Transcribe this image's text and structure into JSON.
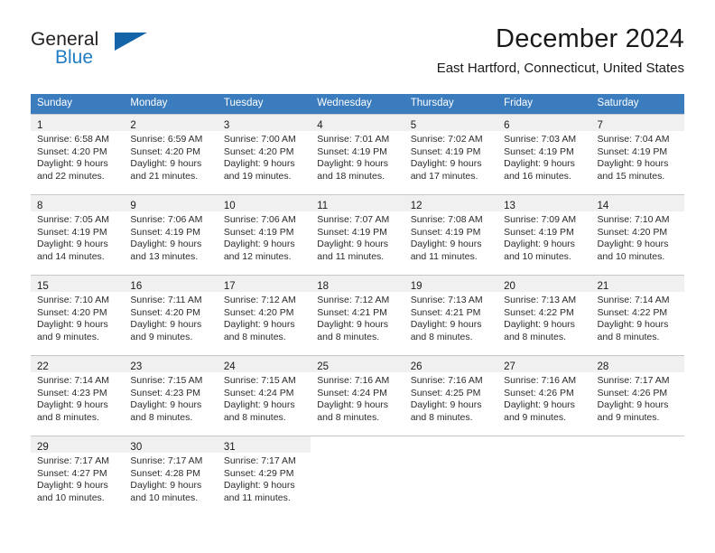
{
  "brand": {
    "name_top": "General",
    "name_bottom": "Blue",
    "triangle_icon": "triangle-logo-icon",
    "colors": {
      "blue": "#1f7dc4",
      "triangle": "#1464aa",
      "dark": "#231f20"
    }
  },
  "header": {
    "title": "December 2024",
    "subtitle": "East Hartford, Connecticut, United States"
  },
  "calendar": {
    "header_color": "#3a7cbe",
    "daynum_band_color": "#f0f0f0",
    "weekdays": [
      "Sunday",
      "Monday",
      "Tuesday",
      "Wednesday",
      "Thursday",
      "Friday",
      "Saturday"
    ],
    "weeks": [
      [
        {
          "day": "1",
          "sunrise": "Sunrise: 6:58 AM",
          "sunset": "Sunset: 4:20 PM",
          "daylight_line1": "Daylight: 9 hours",
          "daylight_line2": "and 22 minutes."
        },
        {
          "day": "2",
          "sunrise": "Sunrise: 6:59 AM",
          "sunset": "Sunset: 4:20 PM",
          "daylight_line1": "Daylight: 9 hours",
          "daylight_line2": "and 21 minutes."
        },
        {
          "day": "3",
          "sunrise": "Sunrise: 7:00 AM",
          "sunset": "Sunset: 4:20 PM",
          "daylight_line1": "Daylight: 9 hours",
          "daylight_line2": "and 19 minutes."
        },
        {
          "day": "4",
          "sunrise": "Sunrise: 7:01 AM",
          "sunset": "Sunset: 4:19 PM",
          "daylight_line1": "Daylight: 9 hours",
          "daylight_line2": "and 18 minutes."
        },
        {
          "day": "5",
          "sunrise": "Sunrise: 7:02 AM",
          "sunset": "Sunset: 4:19 PM",
          "daylight_line1": "Daylight: 9 hours",
          "daylight_line2": "and 17 minutes."
        },
        {
          "day": "6",
          "sunrise": "Sunrise: 7:03 AM",
          "sunset": "Sunset: 4:19 PM",
          "daylight_line1": "Daylight: 9 hours",
          "daylight_line2": "and 16 minutes."
        },
        {
          "day": "7",
          "sunrise": "Sunrise: 7:04 AM",
          "sunset": "Sunset: 4:19 PM",
          "daylight_line1": "Daylight: 9 hours",
          "daylight_line2": "and 15 minutes."
        }
      ],
      [
        {
          "day": "8",
          "sunrise": "Sunrise: 7:05 AM",
          "sunset": "Sunset: 4:19 PM",
          "daylight_line1": "Daylight: 9 hours",
          "daylight_line2": "and 14 minutes."
        },
        {
          "day": "9",
          "sunrise": "Sunrise: 7:06 AM",
          "sunset": "Sunset: 4:19 PM",
          "daylight_line1": "Daylight: 9 hours",
          "daylight_line2": "and 13 minutes."
        },
        {
          "day": "10",
          "sunrise": "Sunrise: 7:06 AM",
          "sunset": "Sunset: 4:19 PM",
          "daylight_line1": "Daylight: 9 hours",
          "daylight_line2": "and 12 minutes."
        },
        {
          "day": "11",
          "sunrise": "Sunrise: 7:07 AM",
          "sunset": "Sunset: 4:19 PM",
          "daylight_line1": "Daylight: 9 hours",
          "daylight_line2": "and 11 minutes."
        },
        {
          "day": "12",
          "sunrise": "Sunrise: 7:08 AM",
          "sunset": "Sunset: 4:19 PM",
          "daylight_line1": "Daylight: 9 hours",
          "daylight_line2": "and 11 minutes."
        },
        {
          "day": "13",
          "sunrise": "Sunrise: 7:09 AM",
          "sunset": "Sunset: 4:19 PM",
          "daylight_line1": "Daylight: 9 hours",
          "daylight_line2": "and 10 minutes."
        },
        {
          "day": "14",
          "sunrise": "Sunrise: 7:10 AM",
          "sunset": "Sunset: 4:20 PM",
          "daylight_line1": "Daylight: 9 hours",
          "daylight_line2": "and 10 minutes."
        }
      ],
      [
        {
          "day": "15",
          "sunrise": "Sunrise: 7:10 AM",
          "sunset": "Sunset: 4:20 PM",
          "daylight_line1": "Daylight: 9 hours",
          "daylight_line2": "and 9 minutes."
        },
        {
          "day": "16",
          "sunrise": "Sunrise: 7:11 AM",
          "sunset": "Sunset: 4:20 PM",
          "daylight_line1": "Daylight: 9 hours",
          "daylight_line2": "and 9 minutes."
        },
        {
          "day": "17",
          "sunrise": "Sunrise: 7:12 AM",
          "sunset": "Sunset: 4:20 PM",
          "daylight_line1": "Daylight: 9 hours",
          "daylight_line2": "and 8 minutes."
        },
        {
          "day": "18",
          "sunrise": "Sunrise: 7:12 AM",
          "sunset": "Sunset: 4:21 PM",
          "daylight_line1": "Daylight: 9 hours",
          "daylight_line2": "and 8 minutes."
        },
        {
          "day": "19",
          "sunrise": "Sunrise: 7:13 AM",
          "sunset": "Sunset: 4:21 PM",
          "daylight_line1": "Daylight: 9 hours",
          "daylight_line2": "and 8 minutes."
        },
        {
          "day": "20",
          "sunrise": "Sunrise: 7:13 AM",
          "sunset": "Sunset: 4:22 PM",
          "daylight_line1": "Daylight: 9 hours",
          "daylight_line2": "and 8 minutes."
        },
        {
          "day": "21",
          "sunrise": "Sunrise: 7:14 AM",
          "sunset": "Sunset: 4:22 PM",
          "daylight_line1": "Daylight: 9 hours",
          "daylight_line2": "and 8 minutes."
        }
      ],
      [
        {
          "day": "22",
          "sunrise": "Sunrise: 7:14 AM",
          "sunset": "Sunset: 4:23 PM",
          "daylight_line1": "Daylight: 9 hours",
          "daylight_line2": "and 8 minutes."
        },
        {
          "day": "23",
          "sunrise": "Sunrise: 7:15 AM",
          "sunset": "Sunset: 4:23 PM",
          "daylight_line1": "Daylight: 9 hours",
          "daylight_line2": "and 8 minutes."
        },
        {
          "day": "24",
          "sunrise": "Sunrise: 7:15 AM",
          "sunset": "Sunset: 4:24 PM",
          "daylight_line1": "Daylight: 9 hours",
          "daylight_line2": "and 8 minutes."
        },
        {
          "day": "25",
          "sunrise": "Sunrise: 7:16 AM",
          "sunset": "Sunset: 4:24 PM",
          "daylight_line1": "Daylight: 9 hours",
          "daylight_line2": "and 8 minutes."
        },
        {
          "day": "26",
          "sunrise": "Sunrise: 7:16 AM",
          "sunset": "Sunset: 4:25 PM",
          "daylight_line1": "Daylight: 9 hours",
          "daylight_line2": "and 8 minutes."
        },
        {
          "day": "27",
          "sunrise": "Sunrise: 7:16 AM",
          "sunset": "Sunset: 4:26 PM",
          "daylight_line1": "Daylight: 9 hours",
          "daylight_line2": "and 9 minutes."
        },
        {
          "day": "28",
          "sunrise": "Sunrise: 7:17 AM",
          "sunset": "Sunset: 4:26 PM",
          "daylight_line1": "Daylight: 9 hours",
          "daylight_line2": "and 9 minutes."
        }
      ],
      [
        {
          "day": "29",
          "sunrise": "Sunrise: 7:17 AM",
          "sunset": "Sunset: 4:27 PM",
          "daylight_line1": "Daylight: 9 hours",
          "daylight_line2": "and 10 minutes."
        },
        {
          "day": "30",
          "sunrise": "Sunrise: 7:17 AM",
          "sunset": "Sunset: 4:28 PM",
          "daylight_line1": "Daylight: 9 hours",
          "daylight_line2": "and 10 minutes."
        },
        {
          "day": "31",
          "sunrise": "Sunrise: 7:17 AM",
          "sunset": "Sunset: 4:29 PM",
          "daylight_line1": "Daylight: 9 hours",
          "daylight_line2": "and 11 minutes."
        },
        {
          "day": "",
          "sunrise": "",
          "sunset": "",
          "daylight_line1": "",
          "daylight_line2": ""
        },
        {
          "day": "",
          "sunrise": "",
          "sunset": "",
          "daylight_line1": "",
          "daylight_line2": ""
        },
        {
          "day": "",
          "sunrise": "",
          "sunset": "",
          "daylight_line1": "",
          "daylight_line2": ""
        },
        {
          "day": "",
          "sunrise": "",
          "sunset": "",
          "daylight_line1": "",
          "daylight_line2": ""
        }
      ]
    ]
  }
}
